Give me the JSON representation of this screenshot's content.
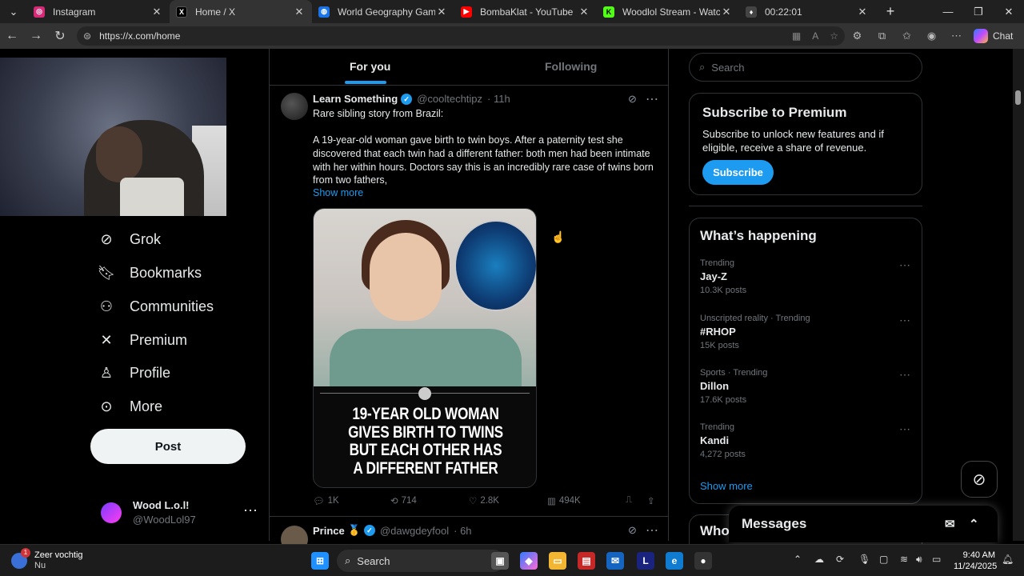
{
  "browser": {
    "tabs": [
      {
        "label": "Instagram",
        "fav_color": "#d62976",
        "fav_glyph": "◎"
      },
      {
        "label": "Home / X",
        "fav_color": "#000000",
        "fav_glyph": "X"
      },
      {
        "label": "World Geography Games On",
        "fav_color": "#1a73e8",
        "fav_glyph": "◍"
      },
      {
        "label": "BombaKlat - YouTube",
        "fav_color": "#ff0000",
        "fav_glyph": "▶"
      },
      {
        "label": "Woodlol Stream - Watch Live",
        "fav_color": "#53fc18",
        "fav_glyph": "K"
      },
      {
        "label": "00:22:01",
        "fav_color": "#444444",
        "fav_glyph": "♦"
      }
    ],
    "url": "https://x.com/home",
    "chat_label": "Chat"
  },
  "sidebar": {
    "items": [
      {
        "label": "Grok",
        "icon": "grok-icon"
      },
      {
        "label": "Bookmarks",
        "icon": "bookmark-icon"
      },
      {
        "label": "Communities",
        "icon": "communities-icon"
      },
      {
        "label": "Premium",
        "icon": "x-logo-icon"
      },
      {
        "label": "Profile",
        "icon": "person-icon"
      },
      {
        "label": "More",
        "icon": "more-circle-icon"
      }
    ],
    "post_label": "Post",
    "account": {
      "name": "Wood L.o.l!",
      "handle": "@WoodLol97"
    }
  },
  "feed": {
    "tabs": {
      "for_you": "For you",
      "following": "Following"
    },
    "tweet1": {
      "name": "Learn Something",
      "handle": "@cooltechtipz",
      "time": "· 11h",
      "line1": "Rare sibling story from Brazil:",
      "body": "A 19-year-old woman gave birth to twin boys. After a paternity test she discovered that each twin had a different father: both men had been intimate with her within hours. Doctors say this is an incredibly rare case of twins born from two fathers,",
      "show_more": "Show more",
      "media_headline": "19-YEAR OLD WOMAN GIVES BIRTH TO TWINS BUT EACH OTHER HAS A DIFFERENT FATHER",
      "replies": "1K",
      "reposts": "714",
      "likes": "2.8K",
      "views": "494K"
    },
    "tweet2": {
      "name": "Prince",
      "badge": "🥇",
      "handle": "@dawgdeyfool",
      "time": "· 6h"
    }
  },
  "right": {
    "search_placeholder": "Search",
    "premium": {
      "title": "Subscribe to Premium",
      "text": "Subscribe to unlock new features and if eligible, receive a share of revenue.",
      "button": "Subscribe"
    },
    "happening": {
      "title": "What’s happening",
      "trends": [
        {
          "context": "Trending",
          "title": "Jay-Z",
          "count": "10.3K posts"
        },
        {
          "context": "Unscripted reality · Trending",
          "title": "#RHOP",
          "count": "15K posts"
        },
        {
          "context": "Sports · Trending",
          "title": "Dillon",
          "count": "17.6K posts"
        },
        {
          "context": "Trending",
          "title": "Kandi",
          "count": "4,272 posts"
        }
      ],
      "show_more": "Show more"
    },
    "who_title": "Who",
    "messages_title": "Messages"
  },
  "taskbar": {
    "weather_line1": "Zeer vochtig",
    "weather_line2": "Nu",
    "weather_badge": "1",
    "search_label": "Search",
    "time": "9:40 AM",
    "date": "11/24/2025"
  },
  "colors": {
    "accent": "#1d9bf0",
    "background": "#000000",
    "border": "#2f3336",
    "muted": "#71767b"
  }
}
